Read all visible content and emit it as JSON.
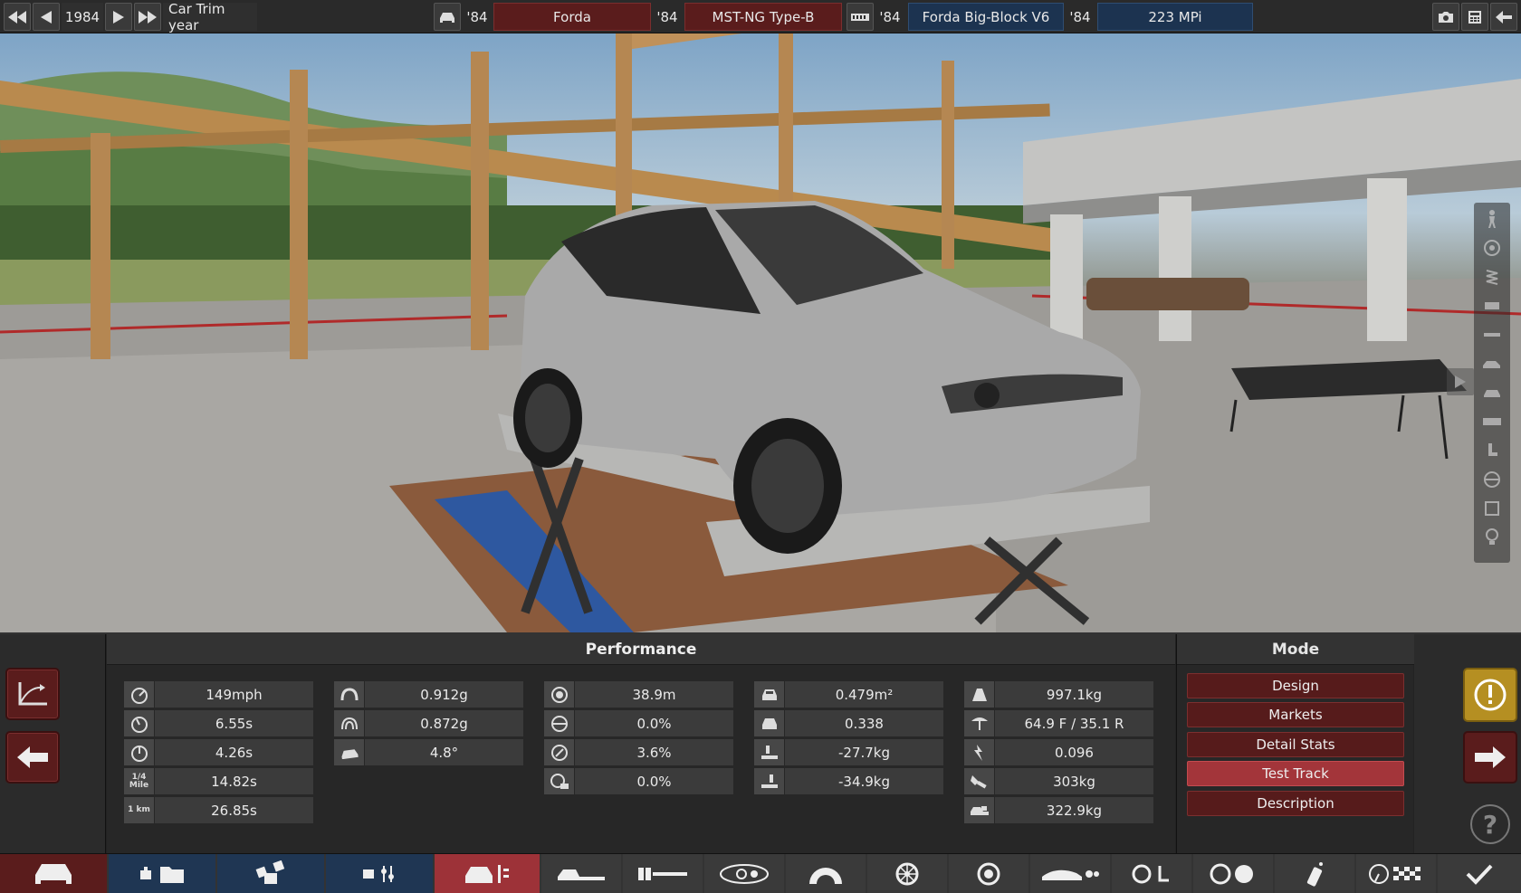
{
  "topbar": {
    "year": "1984",
    "trim_label": "Car Trim year",
    "model_year": "'84",
    "model_name": "Forda",
    "body_year": "'84",
    "body_name": "MST-NG Type-B",
    "engine_year": "'84",
    "engine_name": "Forda Big-Block V6",
    "variant_year": "'84",
    "variant_name": "223 MPi"
  },
  "performance": {
    "title": "Performance",
    "col1": [
      {
        "icon": "speedometer-icon",
        "value": "149mph"
      },
      {
        "icon": "acceleration-60-icon",
        "value": "6.55s"
      },
      {
        "icon": "acceleration-100-icon",
        "value": "4.26s"
      },
      {
        "icon": "quarter-mile-icon",
        "icon_text": "1/4 Mile",
        "value": "14.82s"
      },
      {
        "icon": "one-km-icon",
        "icon_text": "1 km",
        "value": "26.85s"
      }
    ],
    "col2": [
      {
        "icon": "cornering-icon",
        "value": "0.912g"
      },
      {
        "icon": "cornering-alt-icon",
        "value": "0.872g"
      },
      {
        "icon": "body-roll-icon",
        "value": "4.8°"
      }
    ],
    "col3": [
      {
        "icon": "braking-distance-icon",
        "value": "38.9m"
      },
      {
        "icon": "brake-fade-icon",
        "value": "0.0%"
      },
      {
        "icon": "brake-fade-alt-icon",
        "value": "3.6%"
      },
      {
        "icon": "brake-lock-icon",
        "value": "0.0%"
      }
    ],
    "col4": [
      {
        "icon": "frontal-area-icon",
        "value": "0.479m²"
      },
      {
        "icon": "drag-coefficient-icon",
        "value": "0.338"
      },
      {
        "icon": "front-downforce-icon",
        "value": "-27.7kg"
      },
      {
        "icon": "rear-downforce-icon",
        "value": "-34.9kg"
      }
    ],
    "col5": [
      {
        "icon": "weight-icon",
        "value": "997.1kg"
      },
      {
        "icon": "weight-distribution-icon",
        "value": "64.9 F / 35.1 R"
      },
      {
        "icon": "power-weight-icon",
        "value": "0.096"
      },
      {
        "icon": "towing-icon",
        "value": "303kg"
      },
      {
        "icon": "cargo-icon",
        "value": "322.9kg"
      }
    ]
  },
  "mode": {
    "title": "Mode",
    "buttons": [
      {
        "label": "Design",
        "active": false
      },
      {
        "label": "Markets",
        "active": false
      },
      {
        "label": "Detail Stats",
        "active": false
      },
      {
        "label": "Test Track",
        "active": true
      },
      {
        "label": "Description",
        "active": false
      }
    ]
  },
  "help": {
    "label": "?"
  },
  "colors": {
    "accent_red": "#5a1c1c",
    "active_red": "#9d3238",
    "blue": "#1f3653",
    "warning": "#b58f22"
  }
}
